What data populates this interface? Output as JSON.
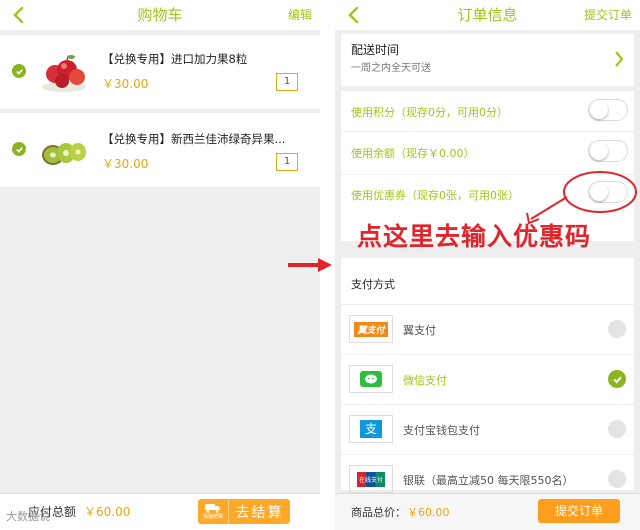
{
  "cart": {
    "title": "购物车",
    "edit_label": "编辑",
    "items": [
      {
        "name": "【兑换专用】进口加力果8粒",
        "price": "￥30.00",
        "qty": "1"
      },
      {
        "name": "【兑换专用】新西兰佳沛绿奇异果...",
        "price": "￥30.00",
        "qty": "1"
      }
    ],
    "total_label": "应付总额",
    "total_value": "￥60.00",
    "checkout_label": "去结算",
    "quick_label": "快速结算"
  },
  "watermark": "大数据说",
  "order": {
    "title": "订单信息",
    "submit_top_label": "提交订单",
    "delivery_title": "配送时间",
    "delivery_value": "一周之内全天可送",
    "points_label": "使用积分（现存0分，可用0分）",
    "balance_label": "使用余额（现存￥0.00）",
    "coupon_label": "使用优惠券（现存0张，可用0张）",
    "payment_title": "支付方式",
    "payments": [
      {
        "name": "翼支付",
        "logo_text": "翼支付",
        "selected": false
      },
      {
        "name": "微信支付",
        "logo_text": "",
        "selected": true
      },
      {
        "name": "支付宝钱包支付",
        "logo_text": "支",
        "selected": false
      },
      {
        "name": "银联（最高立减50 每天限550名）",
        "logo_text": "在线支付",
        "selected": false
      }
    ],
    "total_label": "商品总价：",
    "total_value": "￥60.00",
    "submit_label": "提交订单"
  },
  "annotation": "点这里去输入优惠码",
  "colors": {
    "accent": "#9fc61a",
    "price": "#e9a80e",
    "button": "#ffa92b",
    "annotation": "#e0262d"
  },
  "icons": [
    "back-chevron-icon",
    "check-icon",
    "chevron-right-icon",
    "truck-icon",
    "wechat-icon",
    "arrow-right-icon"
  ]
}
